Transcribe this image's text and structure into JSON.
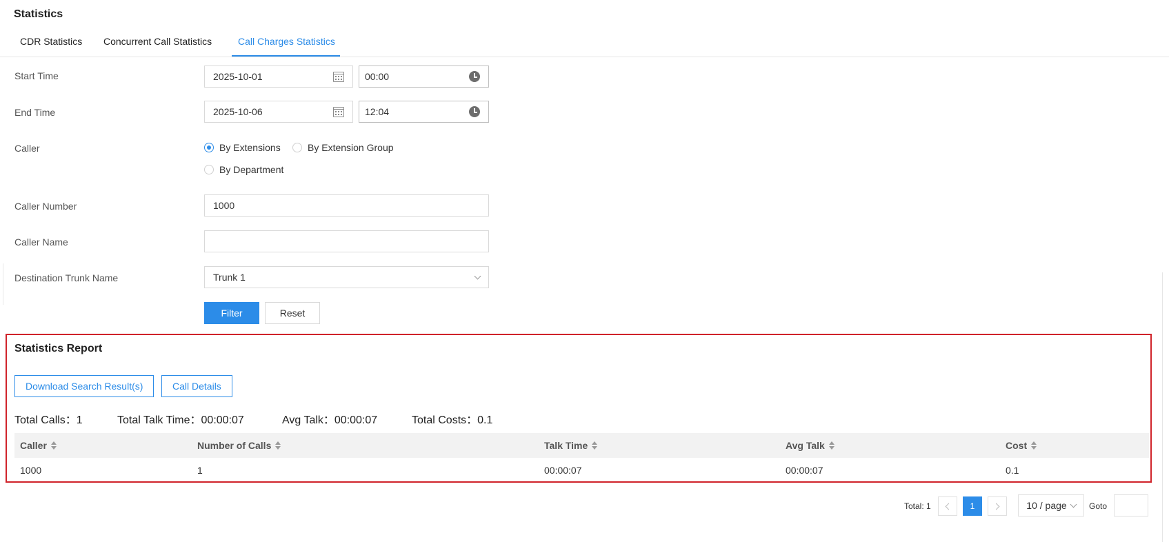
{
  "page": {
    "title": "Statistics"
  },
  "tabs": [
    {
      "label": "CDR Statistics"
    },
    {
      "label": "Concurrent Call Statistics"
    },
    {
      "label": "Call Charges Statistics"
    }
  ],
  "form": {
    "start_time": {
      "label": "Start Time",
      "date": "2025-10-01",
      "time": "00:00"
    },
    "end_time": {
      "label": "End Time",
      "date": "2025-10-06",
      "time": "12:04"
    },
    "caller": {
      "label": "Caller",
      "options": [
        "By Extensions",
        "By Extension Group",
        "By Department"
      ],
      "selected": "By Extensions"
    },
    "caller_number": {
      "label": "Caller Number",
      "value": "1000"
    },
    "caller_name": {
      "label": "Caller Name",
      "value": ""
    },
    "destination_trunk": {
      "label": "Destination Trunk Name",
      "value": "Trunk 1"
    },
    "filter_label": "Filter",
    "reset_label": "Reset"
  },
  "report": {
    "title": "Statistics Report",
    "download_label": "Download Search Result(s)",
    "details_label": "Call Details",
    "summary": {
      "total_calls": "Total Calls：1",
      "total_talk_time": "Total Talk Time：00:00:07",
      "avg_talk": "Avg Talk：00:00:07",
      "total_costs": "Total Costs：0.1"
    },
    "columns": [
      "Caller",
      "Number of Calls",
      "Talk Time",
      "Avg Talk",
      "Cost"
    ],
    "rows": [
      [
        "1000",
        "1",
        "00:00:07",
        "00:00:07",
        "0.1"
      ]
    ]
  },
  "pagination": {
    "total": "Total: 1",
    "current_page": "1",
    "page_size": "10 / page",
    "goto_label": "Goto",
    "goto_value": ""
  },
  "colors": {
    "accent": "#2c8ce8",
    "highlight_border": "#d0232a"
  },
  "icons": [
    "calendar-icon",
    "clock-icon",
    "chevron-down-icon",
    "sort-icon",
    "chevron-left-icon",
    "chevron-right-icon"
  ]
}
